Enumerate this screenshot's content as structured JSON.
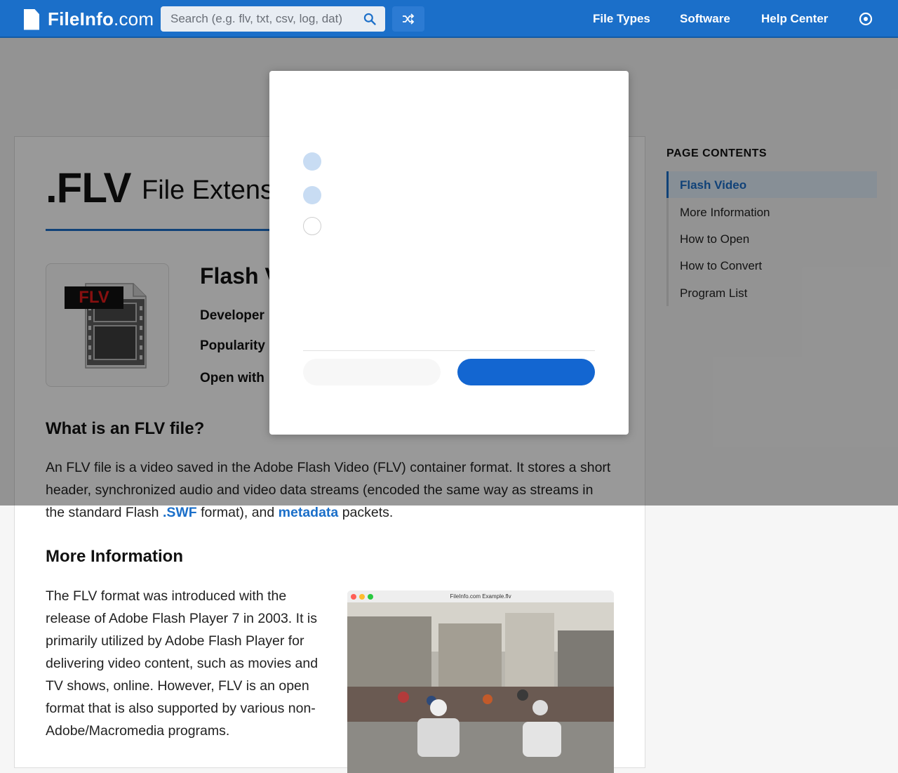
{
  "header": {
    "logo_text_bold": "FileInfo",
    "logo_text_light": ".com",
    "search_placeholder": "Search (e.g. flv, txt, csv, log, dat)",
    "nav": [
      "File Types",
      "Software",
      "Help Center"
    ]
  },
  "page": {
    "extension": ".FLV",
    "subtitle": "File Extension",
    "file_icon_label": "FLV",
    "file_type_title": "Flash Video",
    "meta_labels": [
      "Developer",
      "Popularity",
      "Open with"
    ],
    "what_is_heading": "What is an FLV file?",
    "what_is_text_1": "An FLV file is a video saved in the Adobe Flash Video (FLV) container format. It stores a short header, synchronized audio and video data streams (encoded the same way as streams in the standard Flash ",
    "link_swf": ".SWF",
    "what_is_text_2": " format), and ",
    "link_metadata": "metadata",
    "what_is_text_3": " packets.",
    "more_info_heading": "More Information",
    "more_info_text": "The FLV format was introduced with the release of Adobe Flash Player 7 in 2003. It is primarily utilized by Adobe Flash Player for delivering video content, such as movies and TV shows, online. However, FLV is an open format that is also supported by various non-Adobe/Macromedia programs.",
    "video_window_title": "FileInfo.com Example.flv"
  },
  "sidebar": {
    "title": "PAGE CONTENTS",
    "items": [
      "Flash Video",
      "More Information",
      "How to Open",
      "How to Convert",
      "Program List"
    ],
    "active_index": 0
  },
  "modal": {
    "options_selected": [
      true,
      true,
      false
    ]
  },
  "colors": {
    "brand": "#1b6fc9",
    "primary_button": "#1366d1"
  }
}
